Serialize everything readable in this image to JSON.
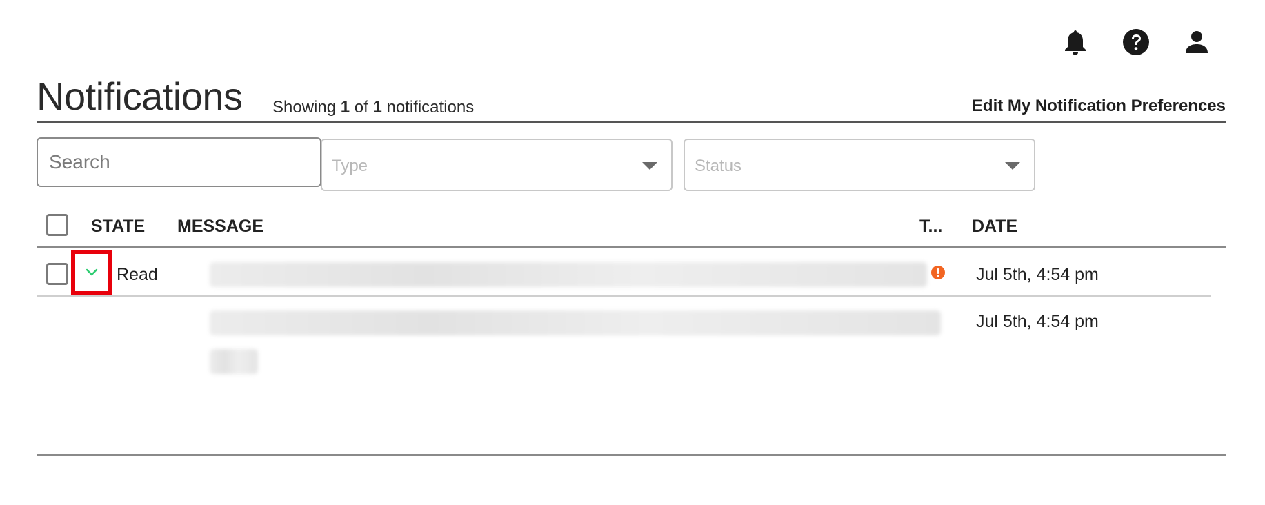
{
  "top_bar": {
    "icons": [
      "bell-icon",
      "help-icon",
      "user-icon"
    ]
  },
  "header": {
    "title": "Notifications",
    "showing_prefix": "Showing",
    "showing_count": "1",
    "showing_of": "of",
    "showing_total": "1",
    "showing_suffix": "notifications",
    "edit_preferences": "Edit My Notification Preferences"
  },
  "filters": {
    "search_placeholder": "Search",
    "search_value": "",
    "type_placeholder": "Type",
    "status_placeholder": "Status"
  },
  "table": {
    "columns": {
      "state": "STATE",
      "message": "MESSAGE",
      "type": "T...",
      "date": "DATE"
    },
    "rows": [
      {
        "state": "Read",
        "type_icon": "alert-circle-icon",
        "date": "Jul 5th, 4:54 pm",
        "expanded": true,
        "expanded_date": "Jul 5th, 4:54 pm"
      }
    ]
  },
  "colors": {
    "highlight_box": "#e8000b",
    "chevron": "#2ecc71",
    "alert": "#f26522"
  }
}
